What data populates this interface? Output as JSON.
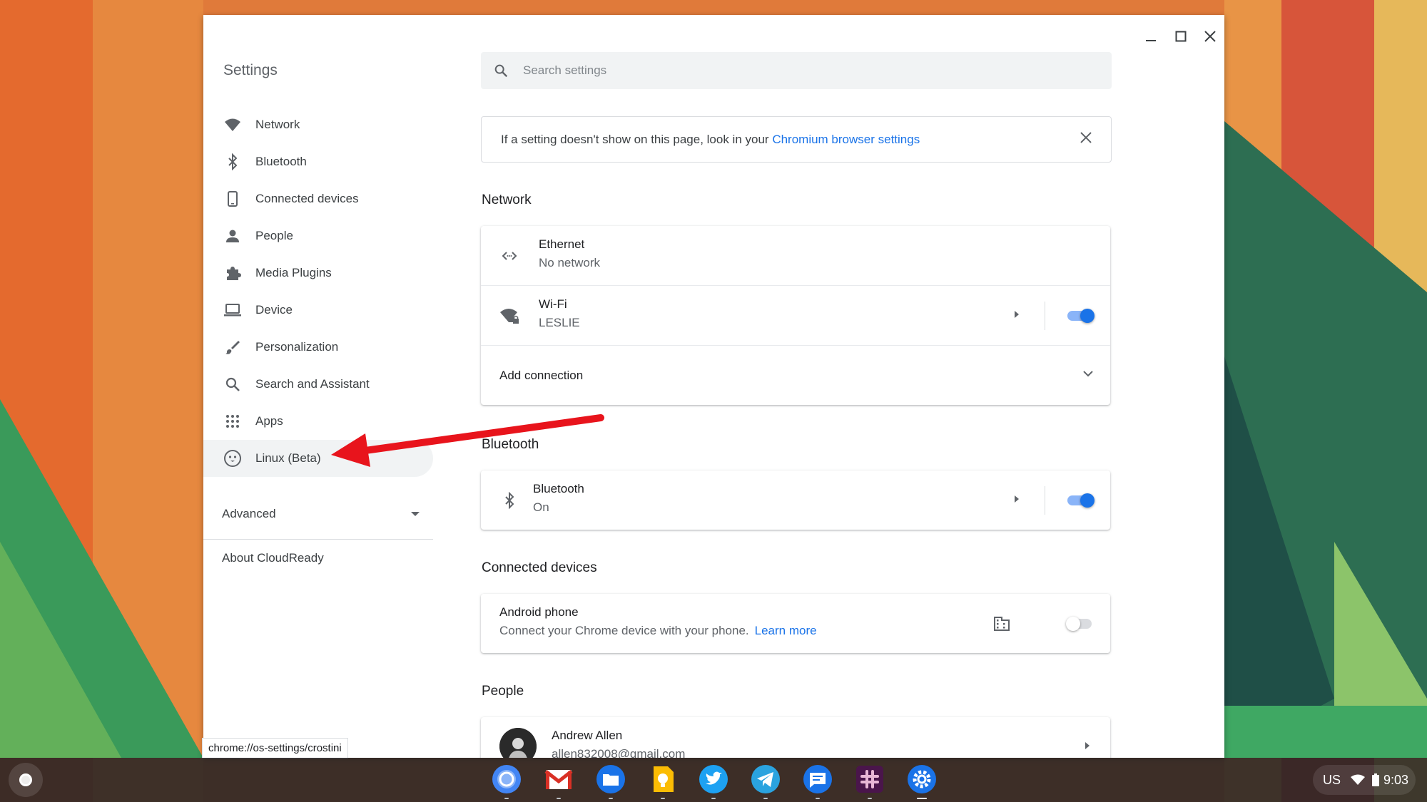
{
  "window": {
    "title": "Settings"
  },
  "sidebar": {
    "items": [
      {
        "label": "Network",
        "icon": "wifi-icon"
      },
      {
        "label": "Bluetooth",
        "icon": "bluetooth-icon"
      },
      {
        "label": "Connected devices",
        "icon": "phone-icon"
      },
      {
        "label": "People",
        "icon": "person-icon"
      },
      {
        "label": "Media Plugins",
        "icon": "puzzle-icon"
      },
      {
        "label": "Device",
        "icon": "laptop-icon"
      },
      {
        "label": "Personalization",
        "icon": "brush-icon"
      },
      {
        "label": "Search and Assistant",
        "icon": "search-icon"
      },
      {
        "label": "Apps",
        "icon": "apps-grid-icon"
      },
      {
        "label": "Linux (Beta)",
        "icon": "penguin-icon",
        "selected": true
      }
    ],
    "advanced": "Advanced",
    "about": "About CloudReady"
  },
  "search": {
    "placeholder": "Search settings",
    "value": ""
  },
  "banner": {
    "text": "If a setting doesn't show on this page, look in your ",
    "link": "Chromium browser settings"
  },
  "network": {
    "title": "Network",
    "ethernet": {
      "title": "Ethernet",
      "status": "No network"
    },
    "wifi": {
      "title": "Wi-Fi",
      "status": "LESLIE",
      "enabled": true
    },
    "add_connection": "Add connection"
  },
  "bluetooth": {
    "title": "Bluetooth",
    "row": {
      "title": "Bluetooth",
      "status": "On",
      "enabled": true
    }
  },
  "connected_devices": {
    "title": "Connected devices",
    "android": {
      "title": "Android phone",
      "description": "Connect your Chrome device with your phone.",
      "learn_more": "Learn more",
      "enabled": false
    }
  },
  "people": {
    "title": "People",
    "account": {
      "name": "Andrew Allen",
      "email": "allen832008@gmail.com"
    }
  },
  "status_url": "chrome://os-settings/crostini",
  "shelf": {
    "apps": [
      "chrome-icon",
      "gmail-icon",
      "files-icon",
      "keep-icon",
      "twitter-icon",
      "telegram-icon",
      "messages-icon",
      "slack-icon",
      "settings-icon"
    ],
    "tray": {
      "input_method": "US",
      "time": "9:03"
    }
  },
  "colors": {
    "accent": "#1a73e8",
    "annotation_arrow": "#e8141c"
  }
}
